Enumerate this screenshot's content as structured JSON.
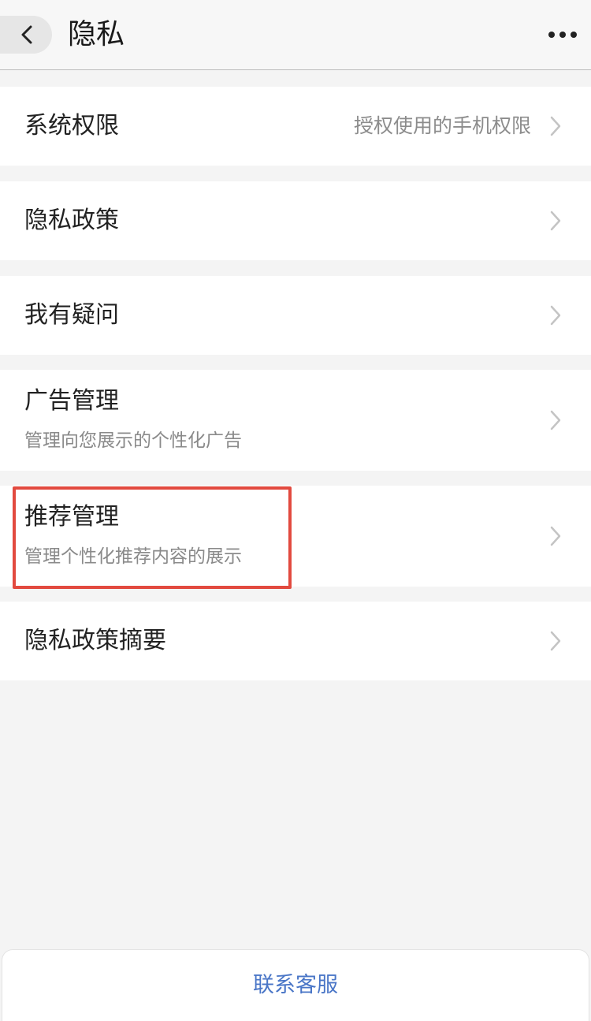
{
  "header": {
    "title": "隐私",
    "back_icon": "chevron-left-icon",
    "more_icon": "more-horizontal-icon"
  },
  "rows": [
    {
      "title": "系统权限",
      "value": "授权使用的手机权限"
    },
    {
      "title": "隐私政策"
    },
    {
      "title": "我有疑问"
    },
    {
      "title": "广告管理",
      "subtitle": "管理向您展示的个性化广告"
    },
    {
      "title": "推荐管理",
      "subtitle": "管理个性化推荐内容的展示"
    },
    {
      "title": "隐私政策摘要"
    }
  ],
  "footer": {
    "contact_label": "联系客服"
  },
  "colors": {
    "background": "#f4f4f4",
    "card": "#ffffff",
    "highlight": "#e24a3f",
    "link": "#4a76c7"
  }
}
